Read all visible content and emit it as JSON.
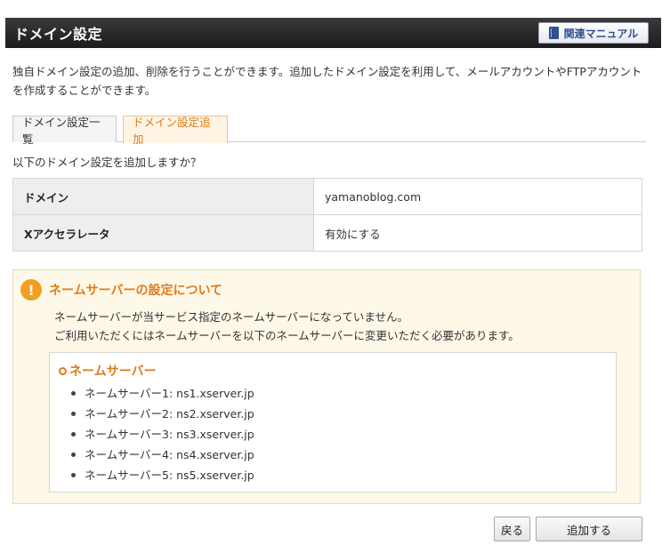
{
  "header": {
    "title": "ドメイン設定",
    "manual_label": "関連マニュアル"
  },
  "description": "独自ドメイン設定の追加、削除を行うことができます。追加したドメイン設定を利用して、メールアカウントやFTPアカウントを作成することができます。",
  "tabs": [
    {
      "label": "ドメイン設定一覧",
      "active": false
    },
    {
      "label": "ドメイン設定追加",
      "active": true
    }
  ],
  "confirm_text": "以下のドメイン設定を追加しますか？",
  "table": [
    {
      "label": "ドメイン",
      "value": "yamanoblog.com"
    },
    {
      "label": "Xアクセラレータ",
      "value": "有効にする"
    }
  ],
  "warning": {
    "icon": "!",
    "title": "ネームサーバーの設定について",
    "lines": [
      "ネームサーバーが当サービス指定のネームサーバーになっていません。",
      "ご利用いただくにはネームサーバーを以下のネームサーバーに変更いただく必要があります。"
    ],
    "ns_title": "ネームサーバー",
    "ns_items": [
      "ネームサーバー1: ns1.xserver.jp",
      "ネームサーバー2: ns2.xserver.jp",
      "ネームサーバー3: ns3.xserver.jp",
      "ネームサーバー4: ns4.xserver.jp",
      "ネームサーバー5: ns5.xserver.jp"
    ]
  },
  "buttons": {
    "back": "戻る",
    "add": "追加する"
  },
  "colors": {
    "accent": "#e07b1a",
    "header_bg": "#2a2a2a",
    "warning_bg": "#fef8e8"
  }
}
